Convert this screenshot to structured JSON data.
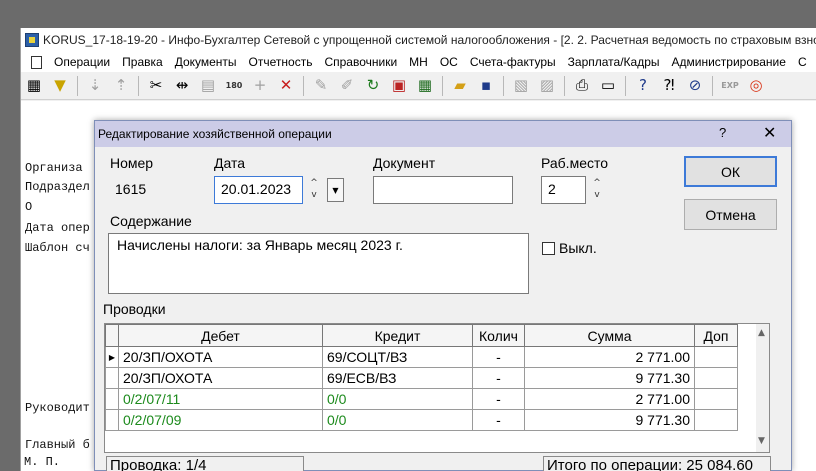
{
  "window": {
    "title": "KORUS_17-18-19-20 - Инфо-Бухгалтер Сетевой с упрощенной системой налогообложения - [2. 2. Расчетная ведомость по страховым взноса"
  },
  "menu": [
    "Операции",
    "Правка",
    "Документы",
    "Отчетность",
    "Справочники",
    "МН",
    "ОС",
    "Счета-фактуры",
    "Зарплата/Кадры",
    "Администрирование",
    "С"
  ],
  "toolbar": {
    "icons": [
      "grid-icon",
      "filter-icon",
      "sort-asc-icon",
      "sort-desc-icon",
      "cut-icon",
      "split-icon",
      "paste-icon",
      "calendar-180-icon",
      "add-icon",
      "delete-icon",
      "pen-icon",
      "pen-gray-icon",
      "refresh-icon",
      "doc-pdf-icon",
      "calculator-icon",
      "open-folder-icon",
      "save-icon",
      "image-icon",
      "chart-icon",
      "print-icon",
      "preview-icon",
      "help-icon",
      "context-help-icon",
      "compass-icon",
      "export-icon",
      "lifebuoy-icon"
    ]
  },
  "report": {
    "lines": [
      "Организа",
      "Подраздел",
      "        О",
      "Дата опер",
      "Шаблон сч",
      "Руководит",
      "Главный б",
      "   М. П."
    ]
  },
  "dialog": {
    "title": "Редактирование хозяйственной операции",
    "help": "?",
    "close": "✕",
    "number_label": "Номер",
    "number_value": "1615",
    "date_label": "Дата",
    "date_value": "20.01.2023",
    "document_label": "Документ",
    "document_value": "",
    "workplace_label": "Раб.место",
    "workplace_value": "2",
    "ok_label": "ОК",
    "cancel_label": "Отмена",
    "content_label": "Содержание",
    "content_value": "Начислены налоги:  за Январь месяц 2023 г.",
    "disabled_label": "Выкл.",
    "entries_label": "Проводки",
    "columns": [
      "Дебет",
      "Кредит",
      "Колич",
      "Сумма",
      "Доп"
    ],
    "rows": [
      {
        "debit": "20/ЗП/ОХОТА",
        "credit": "69/СОЦТ/ВЗ",
        "qty": "-",
        "sum": "2 771.00",
        "extra": ""
      },
      {
        "debit": "20/ЗП/ОХОТА",
        "credit": "69/ЕСВ/ВЗ",
        "qty": "-",
        "sum": "9 771.30",
        "extra": ""
      },
      {
        "debit": "0/2/07/11",
        "credit": "0/0",
        "qty": "-",
        "sum": "2 771.00",
        "extra": ""
      },
      {
        "debit": "0/2/07/09",
        "credit": "0/0",
        "qty": "-",
        "sum": "9 771.30",
        "extra": ""
      }
    ],
    "status_entry": "Проводка: 1/4",
    "status_total": "Итого по операции: 25 084.60"
  }
}
